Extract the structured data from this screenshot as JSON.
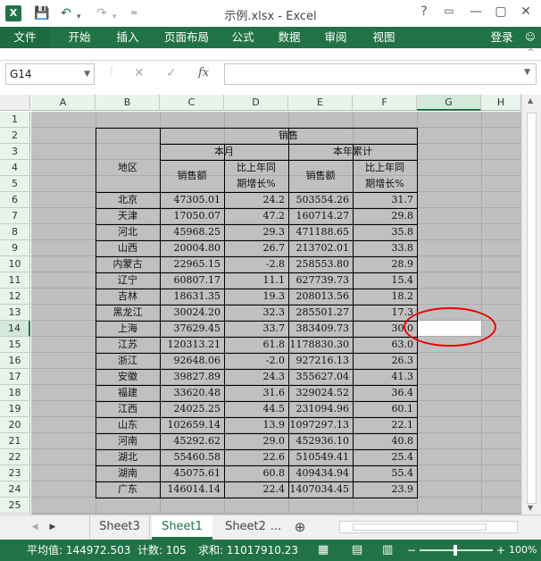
{
  "window": {
    "title": "示例.xlsx - Excel",
    "logo": "X",
    "help": "?",
    "restore_ribbon": "▭",
    "minimize": "—",
    "maximize": "▢",
    "close": "✕"
  },
  "quick_access": {
    "save_icon": "save-icon",
    "undo_icon": "undo-icon",
    "redo_icon": "redo-icon",
    "customize": "="
  },
  "ribbon": {
    "tabs": [
      "文件",
      "开始",
      "插入",
      "页面布局",
      "公式",
      "数据",
      "审阅",
      "视图"
    ],
    "login": "登录"
  },
  "formula_bar": {
    "name_box": "G14",
    "cancel": "✕",
    "confirm": "✓",
    "fx": "fx",
    "value": ""
  },
  "columns": [
    "A",
    "B",
    "C",
    "D",
    "E",
    "F",
    "G",
    "H"
  ],
  "rows": [
    "1",
    "2",
    "3",
    "4",
    "5",
    "6",
    "7",
    "8",
    "9",
    "10",
    "11",
    "12",
    "13",
    "14",
    "15",
    "16",
    "17",
    "18",
    "19",
    "20",
    "21",
    "22",
    "23",
    "24",
    "25"
  ],
  "table": {
    "header_sales": "销售",
    "header_region": "地区",
    "header_month": "本月",
    "header_ytd": "本年累计",
    "header_sales_amt": "销售额",
    "header_growth_1": "比上年同",
    "header_growth_2": "期增长%",
    "header_sales_amt2": "销售额",
    "header_growth2_1": "比上年同",
    "header_growth2_2": "期增长%",
    "rows": [
      [
        "北京",
        "47305.01",
        "24.2",
        "503554.26",
        "31.7"
      ],
      [
        "天津",
        "17050.07",
        "47.2",
        "160714.27",
        "29.8"
      ],
      [
        "河北",
        "45968.25",
        "29.3",
        "471188.65",
        "35.8"
      ],
      [
        "山西",
        "20004.80",
        "26.7",
        "213702.01",
        "33.8"
      ],
      [
        "内蒙古",
        "22965.15",
        "-2.8",
        "258553.80",
        "28.9"
      ],
      [
        "辽宁",
        "60807.17",
        "11.1",
        "627739.73",
        "15.4"
      ],
      [
        "吉林",
        "18631.35",
        "19.3",
        "208013.56",
        "18.2"
      ],
      [
        "黑龙江",
        "30024.20",
        "32.3",
        "285501.27",
        "17.3"
      ],
      [
        "上海",
        "37629.45",
        "33.7",
        "383409.73",
        "30.0"
      ],
      [
        "江苏",
        "120313.21",
        "61.8",
        "1178830.30",
        "63.0"
      ],
      [
        "浙江",
        "92648.06",
        "-2.0",
        "927216.13",
        "26.3"
      ],
      [
        "安徽",
        "39827.89",
        "24.3",
        "355627.04",
        "41.3"
      ],
      [
        "福建",
        "33620.48",
        "31.6",
        "329024.52",
        "36.4"
      ],
      [
        "江西",
        "24025.25",
        "44.5",
        "231094.96",
        "60.1"
      ],
      [
        "山东",
        "102659.14",
        "13.9",
        "1097297.13",
        "22.1"
      ],
      [
        "河南",
        "45292.62",
        "29.0",
        "452936.10",
        "40.8"
      ],
      [
        "湖北",
        "55460.58",
        "22.6",
        "510549.41",
        "25.4"
      ],
      [
        "湖南",
        "45075.61",
        "60.8",
        "409434.94",
        "55.4"
      ],
      [
        "广东",
        "146014.14",
        "22.4",
        "1407034.45",
        "23.9"
      ]
    ]
  },
  "sheet_tabs": {
    "prev": "◀",
    "next": "▶",
    "tabs": [
      "Sheet3",
      "Sheet1",
      "Sheet2"
    ],
    "more": "...",
    "add": "⊕"
  },
  "status": {
    "average": "平均值: 144972.503",
    "count": "计数: 105",
    "sum": "求和: 11017910.23",
    "zoom": "100%",
    "zoom_minus": "−",
    "zoom_plus": "+"
  },
  "colors": {
    "brand": "#217346",
    "highlight": "#e00000"
  }
}
